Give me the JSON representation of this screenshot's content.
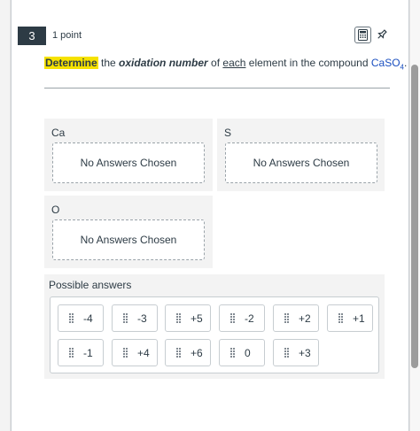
{
  "question": {
    "number": "3",
    "points": "1 point",
    "prompt": {
      "highlight": "Determine",
      "part_the": " the ",
      "italic": "oxidation number",
      "part_of": " of ",
      "underlined": "each",
      "part_rest": " element in the compound ",
      "formula_main": "CaSO",
      "formula_sub": "4",
      "period": "."
    }
  },
  "tools": {
    "calculator_icon": "calculator-icon",
    "pin_icon": "pin-icon"
  },
  "answer_groups": [
    {
      "label": "Ca",
      "placeholder": "No Answers Chosen"
    },
    {
      "label": "S",
      "placeholder": "No Answers Chosen"
    },
    {
      "label": "O",
      "placeholder": "No Answers Chosen"
    }
  ],
  "possible_answers": {
    "title": "Possible answers",
    "tiles": [
      "-4",
      "-3",
      "+5",
      "-2",
      "+2",
      "+1",
      "-1",
      "+4",
      "+6",
      "0",
      "+3"
    ]
  },
  "colors": {
    "highlight": "#f6e200",
    "formula": "#1a4fc0",
    "badge_bg": "#2d3b45"
  }
}
